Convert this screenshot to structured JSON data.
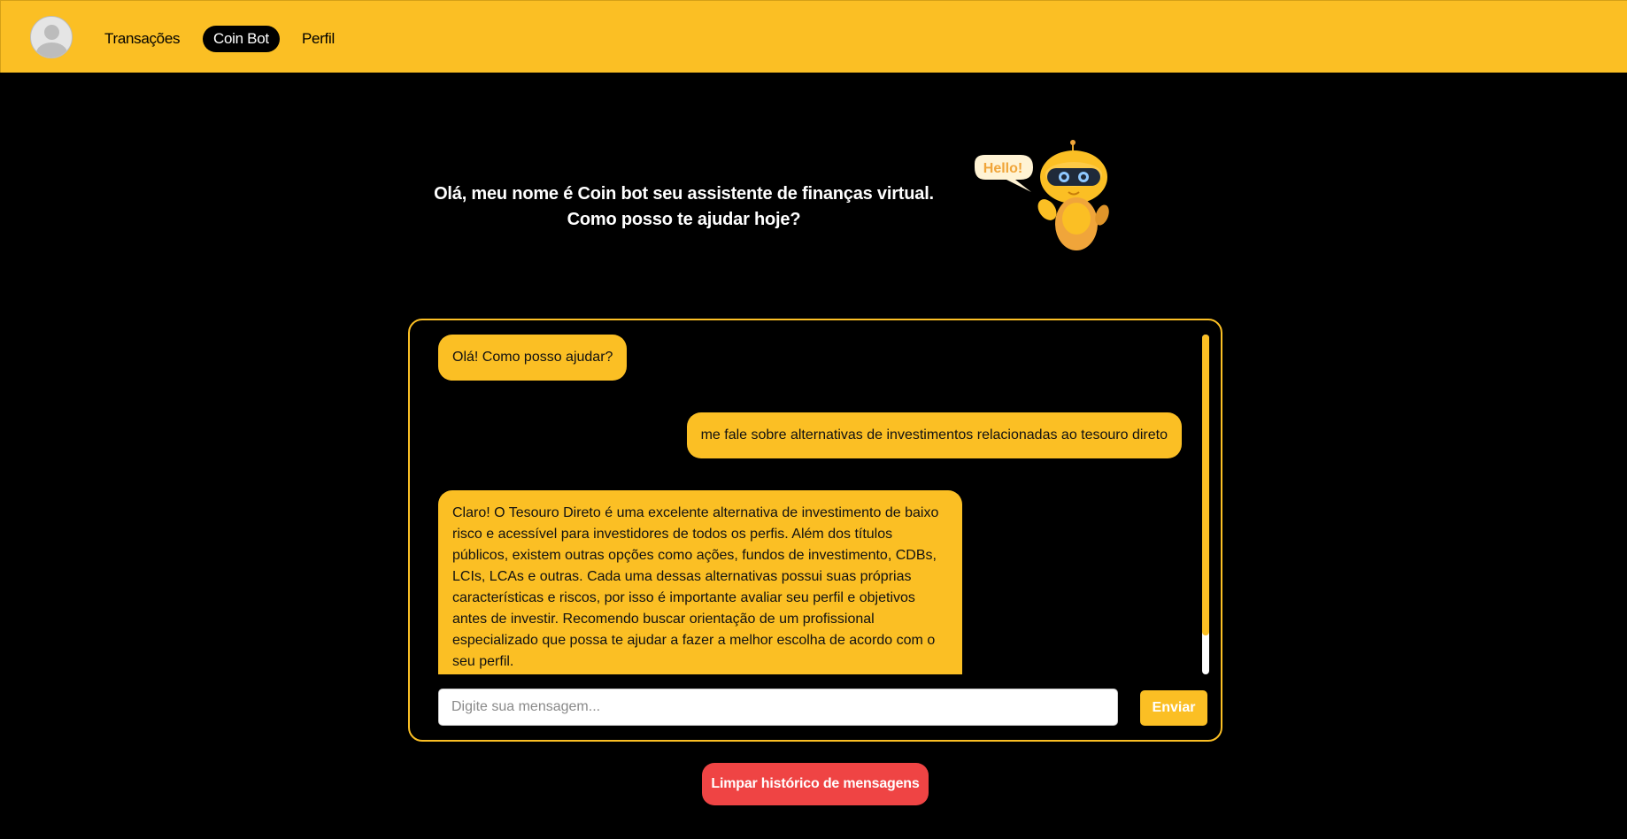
{
  "nav": {
    "items": [
      {
        "label": "Transações",
        "active": false
      },
      {
        "label": "Coin Bot",
        "active": true
      },
      {
        "label": "Perfil",
        "active": false
      }
    ]
  },
  "hero": {
    "line1": "Olá, meu nome é Coin bot seu assistente de finanças virtual.",
    "line2": "Como posso te ajudar hoje?",
    "robot_bubble": "Hello!"
  },
  "chat": {
    "messages": [
      {
        "from": "bot",
        "text": "Olá! Como posso ajudar?"
      },
      {
        "from": "user",
        "text": "me fale sobre alternativas de investimentos relacionadas ao tesouro direto"
      },
      {
        "from": "bot",
        "text": "Claro! O Tesouro Direto é uma excelente alternativa de investimento de baixo risco e acessível para investidores de todos os perfis. Além dos títulos públicos, existem outras opções como ações, fundos de investimento, CDBs, LCIs, LCAs e outras. Cada uma dessas alternativas possui suas próprias características e riscos, por isso é importante avaliar seu perfil e objetivos antes de investir. Recomendo buscar orientação de um profissional especializado que possa te ajudar a fazer a melhor escolha de acordo com o seu perfil."
      }
    ],
    "input_placeholder": "Digite sua mensagem...",
    "input_value": "",
    "send_label": "Enviar"
  },
  "clear_label": "Limpar histórico de mensagens",
  "colors": {
    "accent": "#fbbf24",
    "background": "#000000",
    "danger": "#ef4444"
  }
}
